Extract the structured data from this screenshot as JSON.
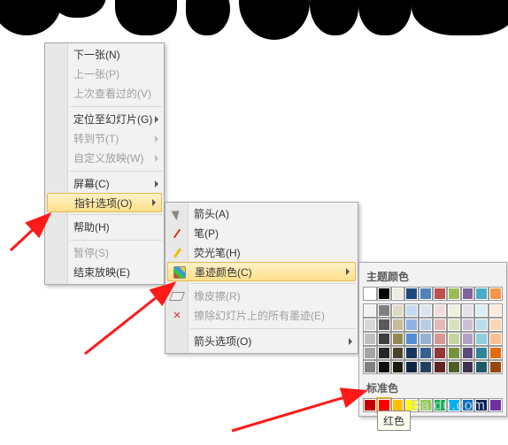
{
  "menu1": {
    "next": "下一张(N)",
    "prev": "上一张(P)",
    "lastViewed": "上次查看过的(V)",
    "gotoSlide": "定位至幻灯片(G)",
    "gotoSection": "转到节(T)",
    "customShow": "自定义放映(W)",
    "screen": "屏幕(C)",
    "pointerOptions": "指针选项(O)",
    "help": "帮助(H)",
    "pause": "暂停(S)",
    "endShow": "结束放映(E)"
  },
  "menu2": {
    "arrow": "箭头(A)",
    "pen": "笔(P)",
    "highlighter": "荧光笔(H)",
    "inkColor": "墨迹颜色(C)",
    "eraser": "橡皮擦(R)",
    "eraseAll": "擦除幻灯片上的所有墨迹(E)",
    "arrowOptions": "箭头选项(O)"
  },
  "palette": {
    "themeHeader": "主题颜色",
    "standardHeader": "标准色",
    "themeTop": [
      "#ffffff",
      "#000000",
      "#eeece1",
      "#1f497d",
      "#4f81bd",
      "#c0504d",
      "#9bbb59",
      "#8064a2",
      "#4bacc6",
      "#f79646"
    ],
    "themeShades": [
      [
        "#f2f2f2",
        "#7f7f7f",
        "#ddd9c3",
        "#c6d9f0",
        "#dbe5f1",
        "#f2dcdb",
        "#ebf1dd",
        "#e5e0ec",
        "#dbeef3",
        "#fdeada"
      ],
      [
        "#d8d8d8",
        "#595959",
        "#c4bd97",
        "#8db3e2",
        "#b8cce4",
        "#e5b9b7",
        "#d7e3bc",
        "#ccc1d9",
        "#b7dde8",
        "#fbd5b5"
      ],
      [
        "#bfbfbf",
        "#3f3f3f",
        "#938953",
        "#548dd4",
        "#95b3d7",
        "#d99694",
        "#c3d69b",
        "#b2a2c7",
        "#92cddc",
        "#fac08f"
      ],
      [
        "#a5a5a5",
        "#262626",
        "#494429",
        "#17365d",
        "#366092",
        "#953734",
        "#76923c",
        "#5f497a",
        "#31859b",
        "#e36c09"
      ],
      [
        "#7f7f7f",
        "#0c0c0c",
        "#1d1b10",
        "#0f243e",
        "#244061",
        "#632423",
        "#4f6128",
        "#3f3151",
        "#205867",
        "#974806"
      ]
    ],
    "standard": [
      "#c00000",
      "#ff0000",
      "#ffc000",
      "#ffff00",
      "#92d050",
      "#00b050",
      "#00b0f0",
      "#0070c0",
      "#002060",
      "#7030a0"
    ]
  },
  "tooltip": "红色",
  "watermark": "Baidu.com"
}
